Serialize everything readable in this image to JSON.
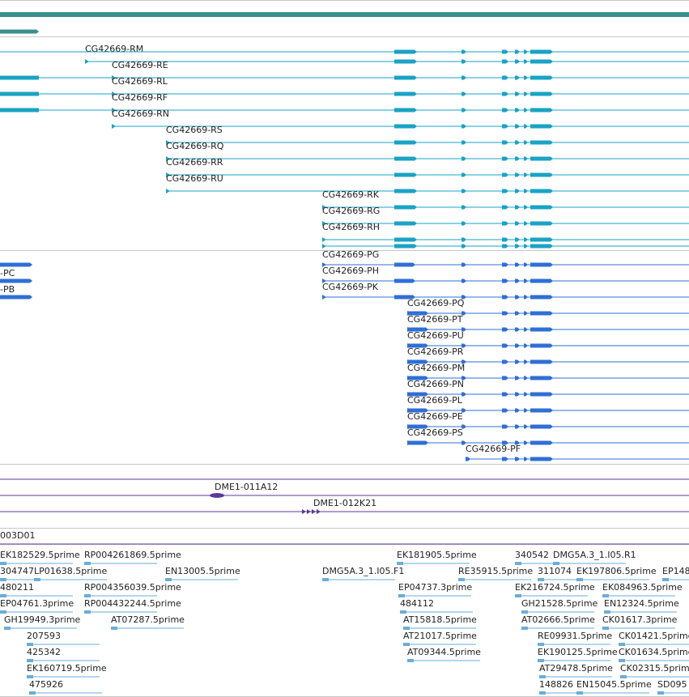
{
  "colors": {
    "gene": "#3a8f8f",
    "rna_r": "#1aa3c4",
    "rna_p": "#2f6fd6",
    "clone": "#5b3a9a",
    "est": "#6aaed8",
    "divider": "#c8c8c8"
  },
  "transcripts_r": [
    {
      "label": "CG42669-RM"
    },
    {
      "label": "CG42669-RE"
    },
    {
      "label": "CG42669-RL"
    },
    {
      "label": "CG42669-RF"
    },
    {
      "label": "CG42669-RN"
    },
    {
      "label": "CG42669-RS"
    },
    {
      "label": "CG42669-RQ"
    },
    {
      "label": "CG42669-RR"
    },
    {
      "label": "CG42669-RU"
    },
    {
      "label": "CG42669-RK"
    },
    {
      "label": "CG42669-RG"
    },
    {
      "label": "CG42669-RH"
    }
  ],
  "transcripts_p": [
    {
      "label": "CG42669-PG"
    },
    {
      "label": "CG42669-PH"
    },
    {
      "label": "CG42669-PK"
    },
    {
      "label": "CG42669-PQ"
    },
    {
      "label": "CG42669-PT"
    },
    {
      "label": "CG42669-PU"
    },
    {
      "label": "CG42669-PR"
    },
    {
      "label": "CG42669-PM"
    },
    {
      "label": "CG42669-PN"
    },
    {
      "label": "CG42669-PL"
    },
    {
      "label": "CG42669-PE"
    },
    {
      "label": "CG42669-PS"
    },
    {
      "label": "CG42669-PF"
    }
  ],
  "p_left_partials": [
    {
      "label": "-PC"
    },
    {
      "label": "-PB"
    }
  ],
  "clones": [
    {
      "label": "DME1-011A12"
    },
    {
      "label": "DME1-012K21"
    },
    {
      "label": "003D01"
    }
  ],
  "ests": [
    {
      "label": "EK182529.5prime"
    },
    {
      "label": "RP004261869.5prime"
    },
    {
      "label": "EK181905.5prime"
    },
    {
      "label": "340542"
    },
    {
      "label": "DMG5A.3_1.I05.R1"
    },
    {
      "label": "304747"
    },
    {
      "label": "LP01638.5prime"
    },
    {
      "label": "EN13005.5prime"
    },
    {
      "label": "DMG5A.3_1.I05.F1"
    },
    {
      "label": "RE35915.5prime"
    },
    {
      "label": "311074"
    },
    {
      "label": "EK197806.5prime"
    },
    {
      "label": "EP148"
    },
    {
      "label": "480211"
    },
    {
      "label": "RP004356039.5prime"
    },
    {
      "label": "EP04737.3prime"
    },
    {
      "label": "EK216724.5prime"
    },
    {
      "label": "EK084963.5prime"
    },
    {
      "label": "EP04761.3prime"
    },
    {
      "label": "RP004432244.5prime"
    },
    {
      "label": "484112"
    },
    {
      "label": "GH21528.5prime"
    },
    {
      "label": "EN12324.5prime"
    },
    {
      "label": "GH19949.3prime"
    },
    {
      "label": "AT07287.5prime"
    },
    {
      "label": "AT15818.5prime"
    },
    {
      "label": "AT02666.5prime"
    },
    {
      "label": "CK01617.3prime"
    },
    {
      "label": "207593"
    },
    {
      "label": "AT21017.5prime"
    },
    {
      "label": "RE09931.5prime"
    },
    {
      "label": "CK01421.5prime"
    },
    {
      "label": "425342"
    },
    {
      "label": "AT09344.5prime"
    },
    {
      "label": "EK190125.5prime"
    },
    {
      "label": "CK01634.5prime"
    },
    {
      "label": "EK160719.5prime"
    },
    {
      "label": "AT29478.5prime"
    },
    {
      "label": "CK02315.5prime"
    },
    {
      "label": "475926"
    },
    {
      "label": "148826"
    },
    {
      "label": "EN15045.5prime"
    },
    {
      "label": "SD095"
    }
  ]
}
